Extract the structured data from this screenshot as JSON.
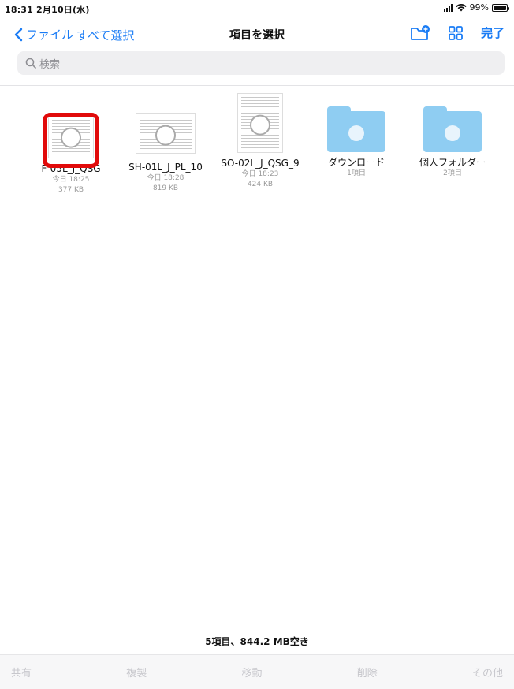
{
  "status_bar": {
    "time": "18:31  2月10日(水)",
    "battery": "99%",
    "icons": [
      "signal-icon",
      "wifi-icon",
      "battery-icon"
    ]
  },
  "nav": {
    "back_label": "ファイル",
    "select_all": "すべて選択",
    "title": "項目を選択",
    "done": "完了",
    "icons": [
      "chevron-left-icon",
      "new-folder-icon",
      "grid-view-icon"
    ]
  },
  "search": {
    "placeholder": "検索"
  },
  "items": [
    {
      "name": "F-05L_J_QSG",
      "date": "今日 18:25",
      "size": "377 KB",
      "type": "document"
    },
    {
      "name": "SH-01L_J_PL_10",
      "date": "今日 18:28",
      "size": "819 KB",
      "type": "document"
    },
    {
      "name": "SO-02L_J_QSG_9",
      "date": "今日 18:23",
      "size": "424 KB",
      "type": "document"
    },
    {
      "name": "ダウンロード",
      "count": "1項目",
      "type": "folder"
    },
    {
      "name": "個人フォルダー",
      "count": "2項目",
      "type": "folder"
    }
  ],
  "footer": {
    "info": "5項目、844.2 MB空き"
  },
  "toolbar": {
    "share": "共有",
    "duplicate": "複製",
    "move": "移動",
    "delete": "削除",
    "more": "その他"
  },
  "colors": {
    "accent": "#1a7cf5",
    "folder": "#8fcdf2",
    "highlight": "#e10a0a"
  }
}
